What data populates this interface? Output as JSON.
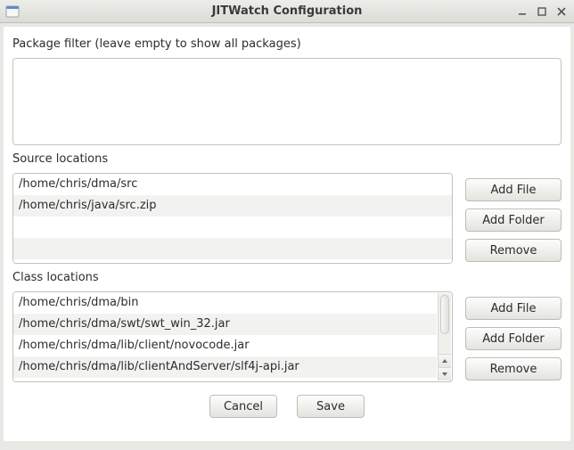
{
  "window": {
    "title": "JITWatch Configuration"
  },
  "package_filter": {
    "label": "Package filter (leave empty to show all packages)",
    "value": ""
  },
  "source_locations": {
    "label": "Source locations",
    "items": [
      "/home/chris/dma/src",
      "/home/chris/java/src.zip"
    ],
    "buttons": {
      "add_file": "Add File",
      "add_folder": "Add Folder",
      "remove": "Remove"
    }
  },
  "class_locations": {
    "label": "Class locations",
    "items": [
      "/home/chris/dma/bin",
      "/home/chris/dma/swt/swt_win_32.jar",
      "/home/chris/dma/lib/client/novocode.jar",
      "/home/chris/dma/lib/clientAndServer/slf4j-api.jar"
    ],
    "buttons": {
      "add_file": "Add File",
      "add_folder": "Add Folder",
      "remove": "Remove"
    }
  },
  "footer": {
    "cancel": "Cancel",
    "save": "Save"
  }
}
